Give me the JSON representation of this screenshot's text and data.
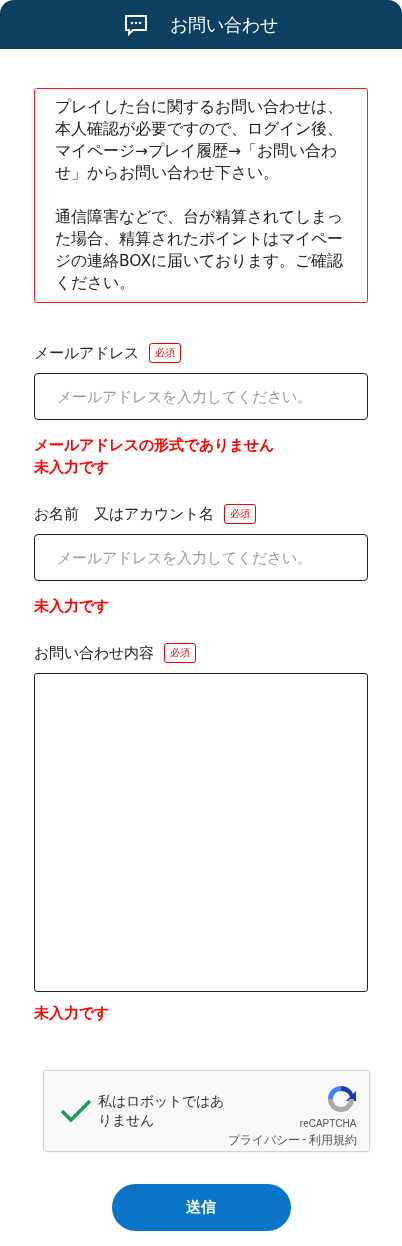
{
  "header": {
    "title": "お問い合わせ"
  },
  "notice": {
    "paragraphs": [
      "プレイした台に関するお問い合わせは、本人確認が必要ですので、ログイン後、マイページ→プレイ履歴→「お問い合わせ」からお問い合わせ下さい。",
      "通信障害などで、台が精算されてしまった場合、精算されたポイントはマイページの連絡BOXに届いております。ご確認ください。"
    ]
  },
  "fields": [
    {
      "kind": "input",
      "label": "メールアドレス",
      "badge": "必須",
      "placeholder": "メールアドレスを入力してください。",
      "errors": [
        "メールアドレスの形式でありません",
        "未入力です"
      ]
    },
    {
      "kind": "input",
      "label": "お名前　又はアカウント名",
      "badge": "必須",
      "placeholder": "メールアドレスを入力してください。",
      "errors": [
        "未入力です"
      ]
    },
    {
      "kind": "textarea",
      "label": "お問い合わせ内容",
      "badge": "必須",
      "errors": [
        "未入力です"
      ]
    }
  ],
  "captcha": {
    "checked": true,
    "label": "私はロボットではありません",
    "brand": "reCAPTCHA",
    "privacy_link": "プライバシー",
    "separator": "-",
    "terms_link": "利用規約"
  },
  "submit_button": "送信"
}
